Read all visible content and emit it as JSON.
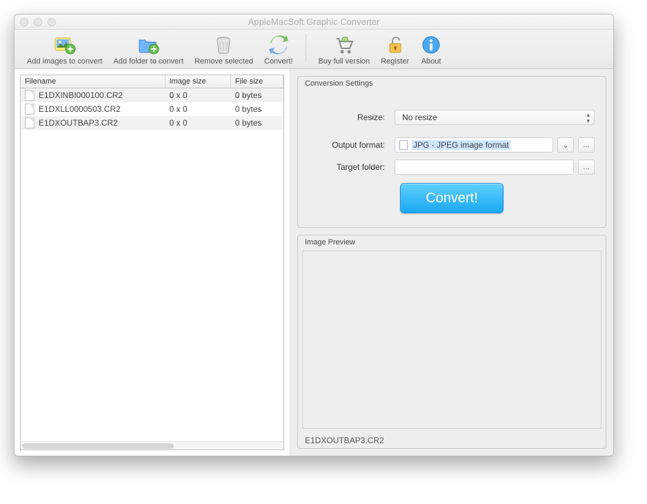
{
  "window": {
    "title": "AppleMacSoft Graphic Converter"
  },
  "toolbar": {
    "add_images": "Add images to convert",
    "add_folder": "Add folder to convert",
    "remove": "Remove selected",
    "convert": "Convert!",
    "buy": "Buy full version",
    "register": "Register",
    "about": "About"
  },
  "file_table": {
    "cols": {
      "filename": "Filename",
      "image_size": "Image size",
      "file_size": "File size"
    },
    "rows": [
      {
        "name": "E1DXINBI000100.CR2",
        "image_size": "0 x 0",
        "file_size": "0 bytes"
      },
      {
        "name": "E1DXLL0000503.CR2",
        "image_size": "0 x 0",
        "file_size": "0 bytes"
      },
      {
        "name": "E1DXOUTBAP3.CR2",
        "image_size": "0 x 0",
        "file_size": "0 bytes"
      }
    ]
  },
  "settings": {
    "panel_title": "Conversion Settings",
    "resize_label": "Resize:",
    "resize_value": "No resize",
    "format_label": "Output format:",
    "format_value": "JPG - JPEG image format",
    "target_label": "Target folder:",
    "target_value": "",
    "dots": "...",
    "convert_button": "Convert!"
  },
  "preview": {
    "panel_title": "Image Preview",
    "filename": "E1DXOUTBAP3.CR2"
  }
}
